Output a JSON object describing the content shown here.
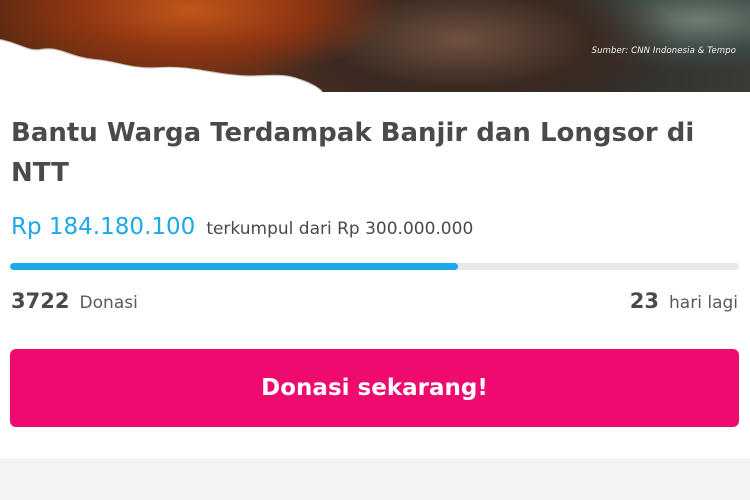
{
  "banner": {
    "source_text": "Sumber: CNN Indonesia & Tempo"
  },
  "campaign": {
    "title": "Bantu Warga Terdampak Banjir dan Longsor di NTT",
    "collected_amount": "Rp 184.180.100",
    "collected_suffix": "terkumpul dari Rp 300.000.000",
    "progress_fraction": 0.614,
    "donation_count": "3722",
    "donation_label": "Donasi",
    "days_left": "23",
    "days_left_label": "hari lagi"
  },
  "actions": {
    "donate_label": "Donasi sekarang!"
  },
  "colors": {
    "accent_blue": "#1ba9ea",
    "button_pink": "#ee0a6f",
    "text_dark": "#4a4a4a"
  }
}
